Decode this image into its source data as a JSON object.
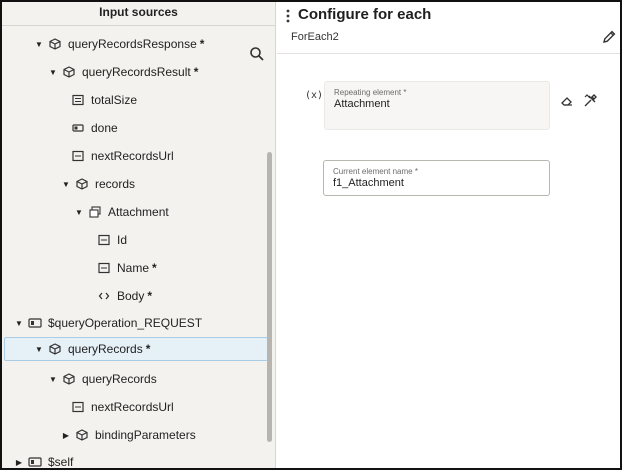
{
  "left_panel": {
    "header": "Input sources",
    "tree": [
      {
        "label": "queryRecordsResponse",
        "required": "*"
      },
      {
        "label": "queryRecordsResult",
        "required": "*"
      },
      {
        "label": "totalSize",
        "required": ""
      },
      {
        "label": "done",
        "required": ""
      },
      {
        "label": "nextRecordsUrl",
        "required": ""
      },
      {
        "label": "records",
        "required": ""
      },
      {
        "label": "Attachment",
        "required": ""
      },
      {
        "label": "Id",
        "required": ""
      },
      {
        "label": "Name",
        "required": "*"
      },
      {
        "label": "Body",
        "required": "*"
      },
      {
        "label": "$queryOperation_REQUEST",
        "required": ""
      },
      {
        "label": "queryRecords",
        "required": "*"
      },
      {
        "label": "queryRecords",
        "required": ""
      },
      {
        "label": "nextRecordsUrl",
        "required": ""
      },
      {
        "label": "bindingParameters",
        "required": ""
      },
      {
        "label": "$self",
        "required": ""
      }
    ]
  },
  "right_panel": {
    "title": "Configure for each",
    "subtitle": "ForEach2",
    "expression_badge": "(x)",
    "repeating_element": {
      "label": "Repeating element *",
      "value": "Attachment"
    },
    "current_element_name": {
      "label": "Current element name *",
      "value": "f1_Attachment"
    }
  },
  "icons": {
    "search": "search-icon",
    "edit": "pencil-icon",
    "clear": "eraser-icon",
    "mapper": "tools-icon",
    "more": "kebab-menu-icon"
  },
  "colors": {
    "panel_bg": "#f4f2ef",
    "selected_bg": "#e6f0f7",
    "selected_border": "#a9cde6"
  }
}
